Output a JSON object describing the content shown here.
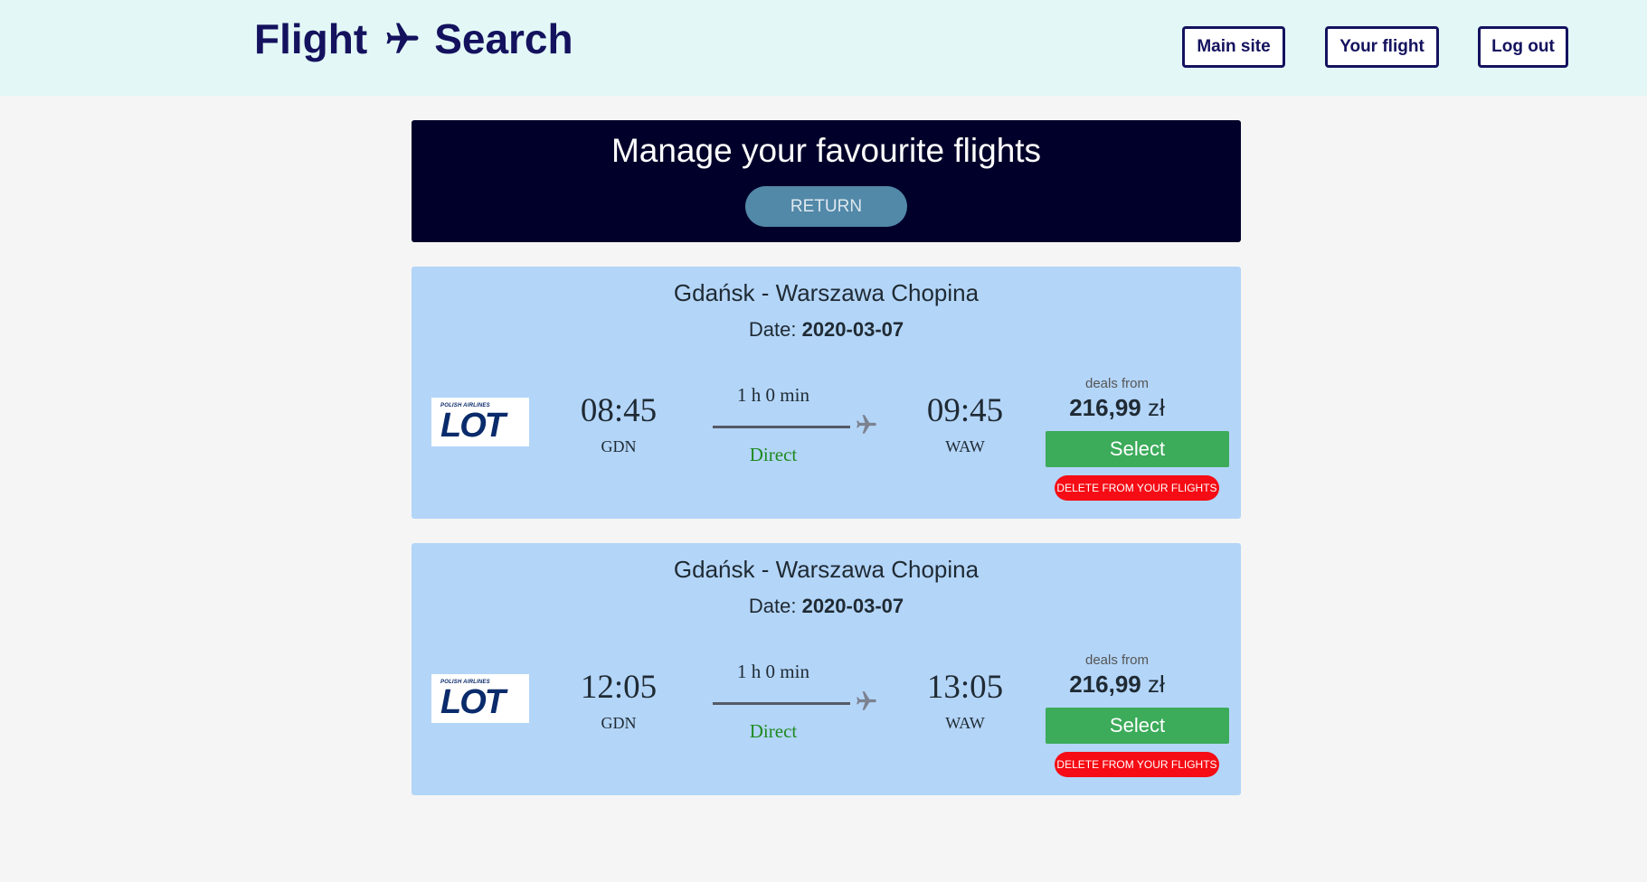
{
  "header": {
    "brand_left": "Flight",
    "brand_icon": "airplane-icon",
    "brand_right": "Search",
    "nav": [
      {
        "label": "Main site"
      },
      {
        "label": "Your flight"
      },
      {
        "label": "Log out"
      }
    ]
  },
  "hero": {
    "title": "Manage your favourite flights",
    "return_label": "RETURN"
  },
  "flights": [
    {
      "route": "Gdańsk - Warszawa Chopina",
      "date_label": "Date:",
      "date": "2020-03-07",
      "airline_logo": {
        "small": "POLISH AIRLINES",
        "big": "LOT"
      },
      "depart_time": "08:45",
      "depart_code": "GDN",
      "duration": "1 h 0 min",
      "stops": "Direct",
      "arrive_time": "09:45",
      "arrive_code": "WAW",
      "deals_label": "deals from",
      "price": "216,99",
      "currency": "zł",
      "select_label": "Select",
      "delete_label": "DELETE FROM YOUR FLIGHTS"
    },
    {
      "route": "Gdańsk - Warszawa Chopina",
      "date_label": "Date:",
      "date": "2020-03-07",
      "airline_logo": {
        "small": "POLISH AIRLINES",
        "big": "LOT"
      },
      "depart_time": "12:05",
      "depart_code": "GDN",
      "duration": "1 h 0 min",
      "stops": "Direct",
      "arrive_time": "13:05",
      "arrive_code": "WAW",
      "deals_label": "deals from",
      "price": "216,99",
      "currency": "zł",
      "select_label": "Select",
      "delete_label": "DELETE FROM YOUR FLIGHTS"
    }
  ],
  "colors": {
    "header_bg": "#e3f8f6",
    "brand": "#14125e",
    "hero_bg": "#01002a",
    "return_btn": "#5288a8",
    "card_bg": "#b3d5f8",
    "select_btn": "#3cab5a",
    "delete_btn": "#f50c14",
    "direct_text": "#1e8a1e"
  }
}
